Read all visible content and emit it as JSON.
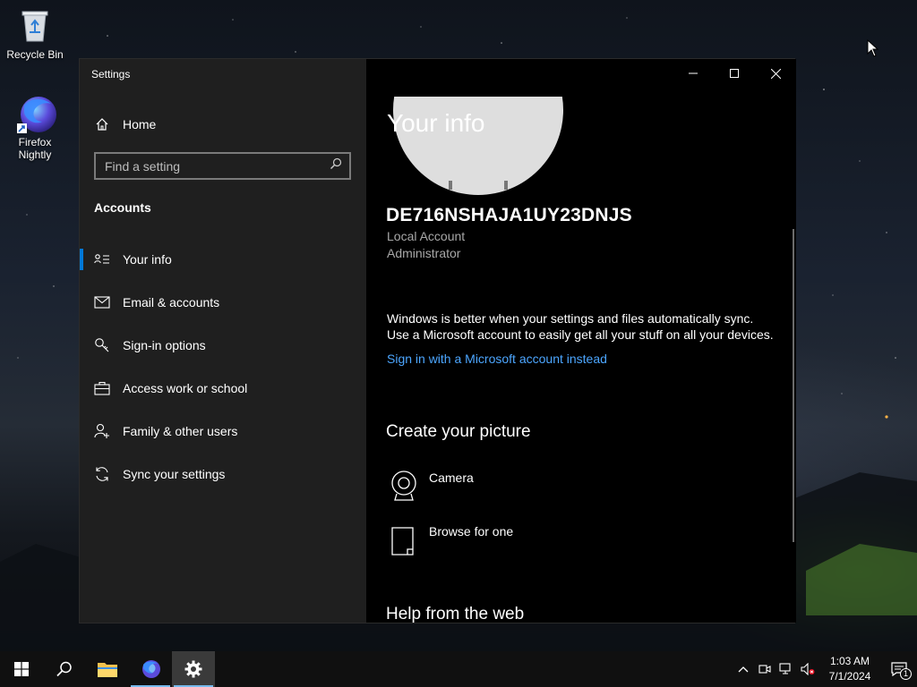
{
  "desktop": {
    "icons": [
      {
        "label": "Recycle Bin"
      },
      {
        "label": "Firefox\nNightly"
      }
    ]
  },
  "window": {
    "title": "Settings",
    "sidebar": {
      "home_label": "Home",
      "search_placeholder": "Find a setting",
      "section_label": "Accounts",
      "items": [
        {
          "label": "Your info",
          "icon": "person-card-icon",
          "active": true
        },
        {
          "label": "Email & accounts",
          "icon": "mail-icon"
        },
        {
          "label": "Sign-in options",
          "icon": "key-icon"
        },
        {
          "label": "Access work or school",
          "icon": "briefcase-icon"
        },
        {
          "label": "Family & other users",
          "icon": "person-add-icon"
        },
        {
          "label": "Sync your settings",
          "icon": "sync-icon"
        }
      ]
    },
    "content": {
      "title": "Your info",
      "username": "DE716NSHAJA1UY23DNJS",
      "account_type": "Local Account",
      "account_role": "Administrator",
      "sync_line1": "Windows is better when your settings and files automatically sync.",
      "sync_line2": "Use a Microsoft account to easily get all your stuff on all your devices.",
      "ms_link": "Sign in with a Microsoft account instead",
      "create_picture_heading": "Create your picture",
      "options": [
        {
          "label": "Camera",
          "icon": "camera-icon"
        },
        {
          "label": "Browse for one",
          "icon": "file-icon"
        }
      ],
      "help_heading": "Help from the web"
    }
  },
  "taskbar": {
    "time": "1:03 AM",
    "date": "7/1/2024",
    "notification_count": "1"
  },
  "colors": {
    "accent": "#0078d7",
    "link": "#4ca6ff",
    "sidebar_bg": "#1f1f1f",
    "content_bg": "#000000"
  }
}
